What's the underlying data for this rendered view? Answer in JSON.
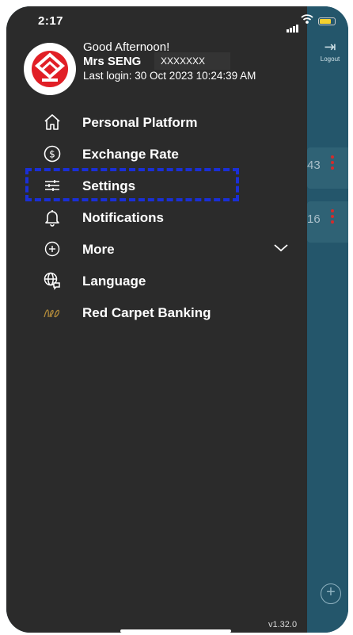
{
  "status_bar": {
    "time": "2:17"
  },
  "header": {
    "greeting": "Good Afternoon!",
    "user_name": "Mrs SENG",
    "masked_id": "XXXXXXX",
    "last_login": "Last login: 30 Oct 2023 10:24:39 AM"
  },
  "menu": [
    {
      "label": "Personal Platform",
      "icon": "home-icon"
    },
    {
      "label": "Exchange Rate",
      "icon": "dollar-circle-icon"
    },
    {
      "label": "Settings",
      "icon": "sliders-icon"
    },
    {
      "label": "Notifications",
      "icon": "bell-icon"
    },
    {
      "label": "More",
      "icon": "plus-circle-icon"
    },
    {
      "label": "Language",
      "icon": "globe-chat-icon"
    },
    {
      "label": "Red Carpet Banking",
      "icon": "rcb-logo-icon"
    }
  ],
  "background": {
    "logout_label": "Logout",
    "card_values": [
      "43",
      "16"
    ]
  },
  "version": "v1.32.0",
  "colors": {
    "drawer": "#2b2b2b",
    "behind": "#1c5268",
    "brand_red": "#e11f26",
    "highlight": "#1a2fd6",
    "battery": "#f5d12e",
    "rcb_gold": "#b18a3a"
  }
}
